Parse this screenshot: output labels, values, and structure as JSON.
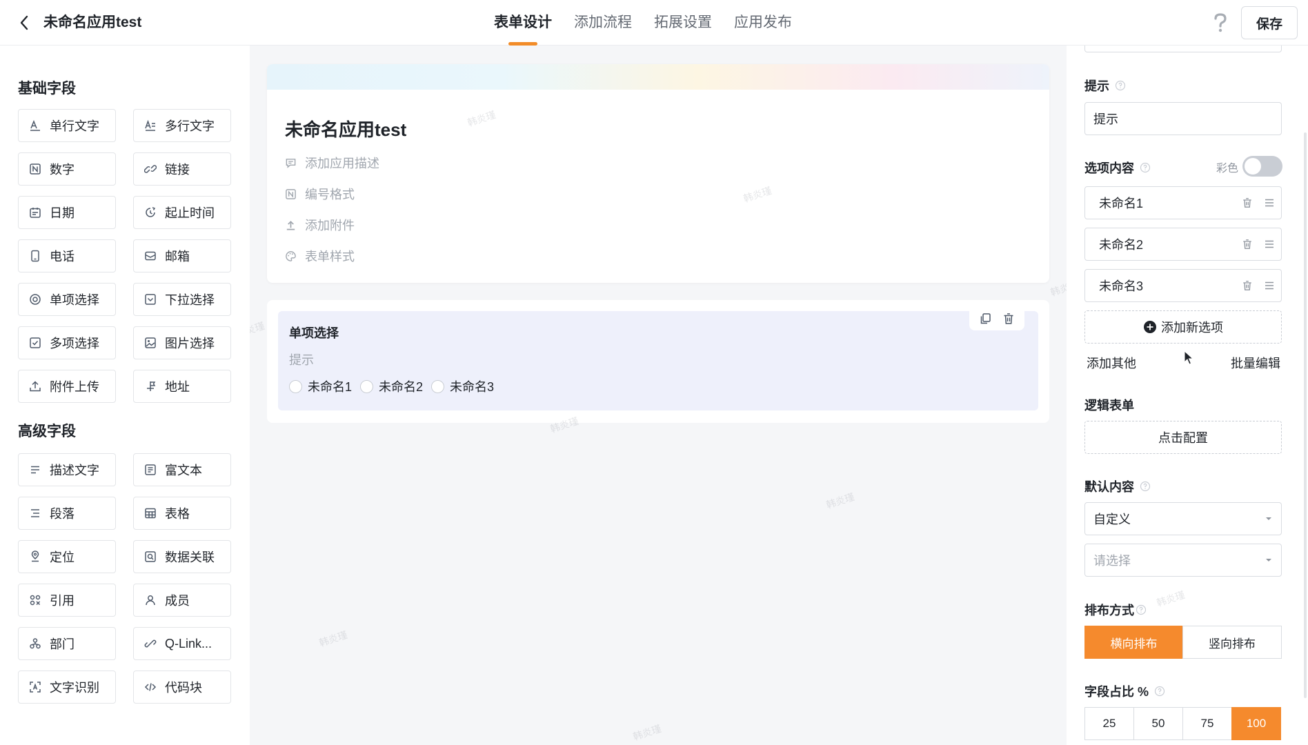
{
  "header": {
    "title": "未命名应用test",
    "tabs": [
      {
        "label": "表单设计",
        "active": true
      },
      {
        "label": "添加流程",
        "active": false
      },
      {
        "label": "拓展设置",
        "active": false
      },
      {
        "label": "应用发布",
        "active": false
      }
    ],
    "save_label": "保存"
  },
  "palette": {
    "basic_title": "基础字段",
    "basic": [
      {
        "label": "单行文字",
        "icon": "single-line-text-icon"
      },
      {
        "label": "多行文字",
        "icon": "multi-line-text-icon"
      },
      {
        "label": "数字",
        "icon": "number-icon"
      },
      {
        "label": "链接",
        "icon": "link-icon"
      },
      {
        "label": "日期",
        "icon": "calendar-icon"
      },
      {
        "label": "起止时间",
        "icon": "time-range-icon"
      },
      {
        "label": "电话",
        "icon": "phone-icon"
      },
      {
        "label": "邮箱",
        "icon": "mail-icon"
      },
      {
        "label": "单项选择",
        "icon": "radio-icon"
      },
      {
        "label": "下拉选择",
        "icon": "dropdown-icon"
      },
      {
        "label": "多项选择",
        "icon": "checkbox-icon"
      },
      {
        "label": "图片选择",
        "icon": "image-icon"
      },
      {
        "label": "附件上传",
        "icon": "upload-icon"
      },
      {
        "label": "地址",
        "icon": "address-icon"
      }
    ],
    "advanced_title": "高级字段",
    "advanced": [
      {
        "label": "描述文字",
        "icon": "description-icon"
      },
      {
        "label": "富文本",
        "icon": "rich-text-icon"
      },
      {
        "label": "段落",
        "icon": "paragraph-icon"
      },
      {
        "label": "表格",
        "icon": "table-icon"
      },
      {
        "label": "定位",
        "icon": "location-icon"
      },
      {
        "label": "数据关联",
        "icon": "data-link-icon"
      },
      {
        "label": "引用",
        "icon": "reference-icon"
      },
      {
        "label": "成员",
        "icon": "member-icon"
      },
      {
        "label": "部门",
        "icon": "department-icon"
      },
      {
        "label": "Q-Link...",
        "icon": "q-link-icon"
      },
      {
        "label": "文字识别",
        "icon": "ocr-icon"
      },
      {
        "label": "代码块",
        "icon": "code-icon"
      }
    ]
  },
  "canvas": {
    "form_title": "未命名应用test",
    "info_items": [
      {
        "label": "添加应用描述",
        "icon": "comment-icon"
      },
      {
        "label": "编号格式",
        "icon": "number-format-icon"
      },
      {
        "label": "添加附件",
        "icon": "attachment-upload-icon"
      },
      {
        "label": "表单样式",
        "icon": "palette-icon"
      }
    ],
    "field": {
      "label": "单项选择",
      "hint": "提示",
      "options": [
        "未命名1",
        "未命名2",
        "未命名3"
      ]
    },
    "watermark_text": "韩炎瑾"
  },
  "panel": {
    "hint_label": "提示",
    "hint_value": "提示",
    "options_label": "选项内容",
    "colorful_label": "彩色",
    "colorful_on": false,
    "options": [
      "未命名1",
      "未命名2",
      "未命名3"
    ],
    "add_option_label": "添加新选项",
    "add_other_label": "添加其他",
    "batch_edit_label": "批量编辑",
    "logic_label": "逻辑表单",
    "logic_button": "点击配置",
    "default_label": "默认内容",
    "default_mode": "自定义",
    "default_placeholder": "请选择",
    "layout_label": "排布方式",
    "layout_options": [
      "横向排布",
      "竖向排布"
    ],
    "layout_selected": "横向排布",
    "width_label": "字段占比 %",
    "width_options": [
      "25",
      "50",
      "75",
      "100"
    ],
    "width_selected": "100"
  },
  "colors": {
    "accent": "#f58a2d",
    "field_highlight": "#eef0fb"
  }
}
